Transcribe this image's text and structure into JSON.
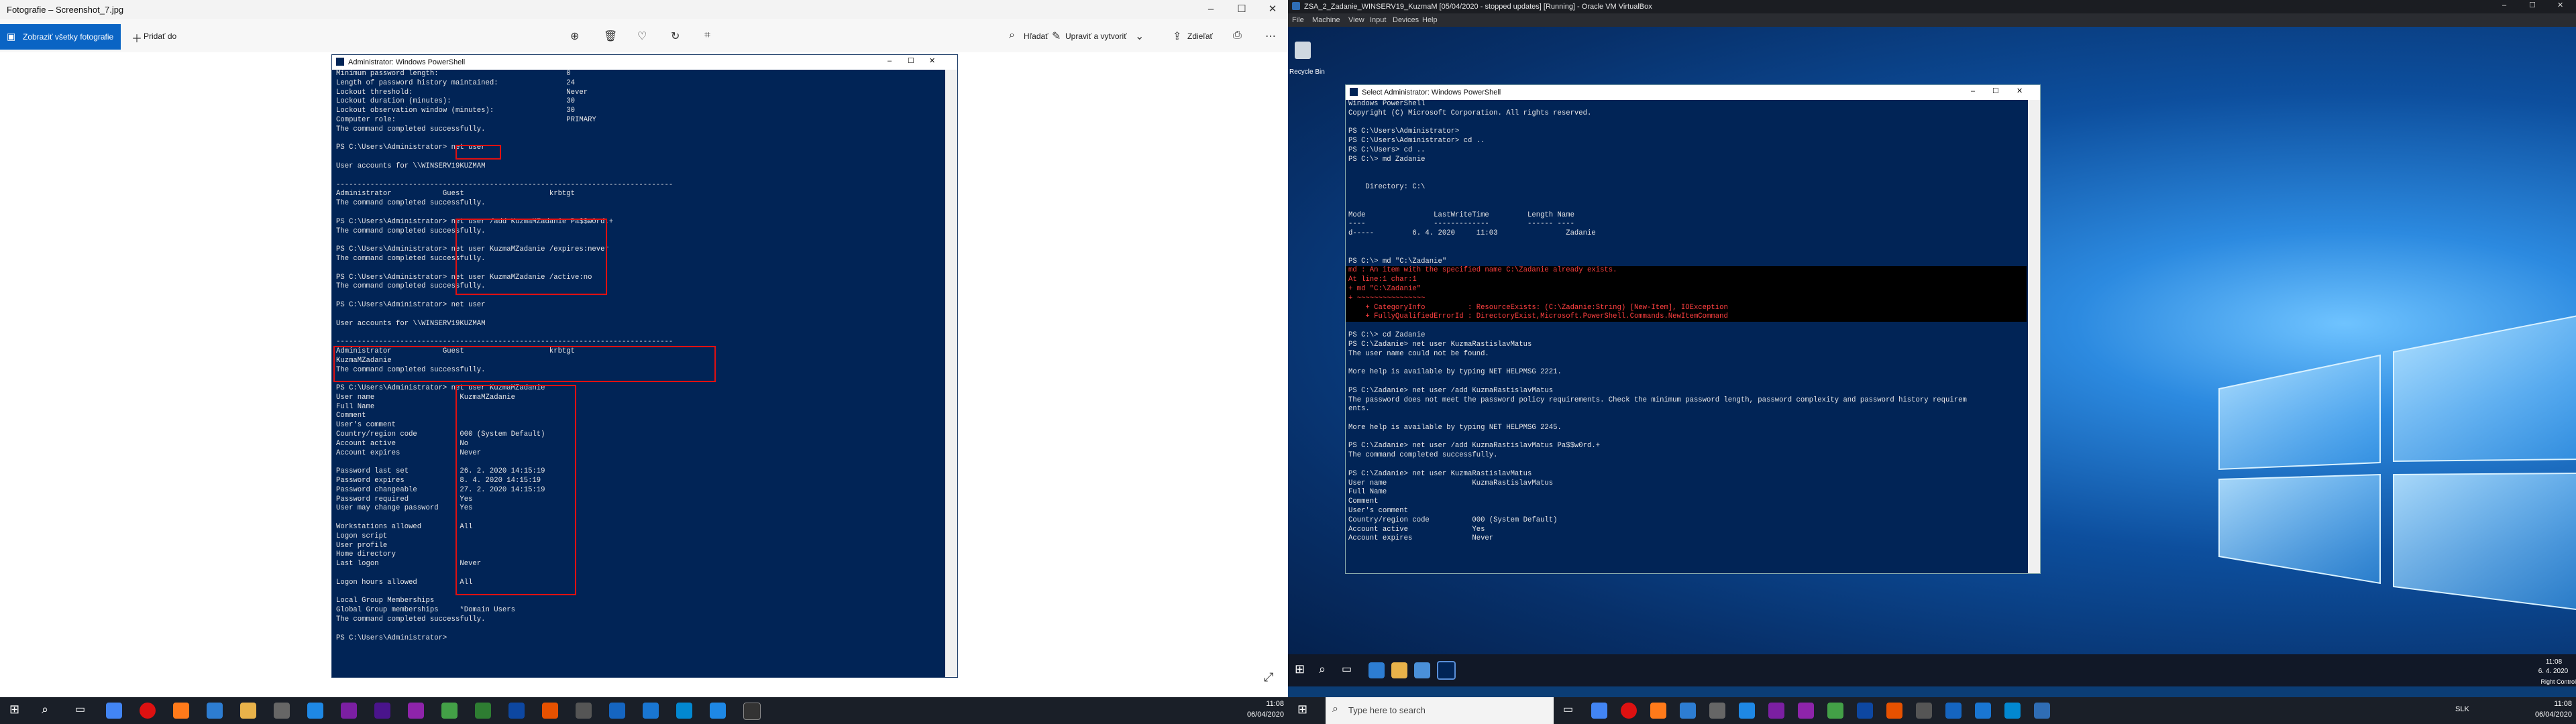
{
  "photos": {
    "title": "Fotografie – Screenshot_7.jpg",
    "all_photos": "Zobraziť všetky fotografie",
    "add_to": "Pridať do",
    "search": "Hľadať",
    "edit_create": "Upraviť a vytvoriť",
    "share": "Zdieľať"
  },
  "ps_photo": {
    "title": "Administrator: Windows PowerShell",
    "lines": [
      "Minimum password length:                              0",
      "Length of password history maintained:                24",
      "Lockout threshold:                                    Never",
      "Lockout duration (minutes):                           30",
      "Lockout observation window (minutes):                 30",
      "Computer role:                                        PRIMARY",
      "The command completed successfully.",
      "",
      "PS C:\\Users\\Administrator> net user",
      "",
      "User accounts for \\\\WINSERV19KUZMAM",
      "",
      "-------------------------------------------------------------------------------",
      "Administrator            Guest                    krbtgt",
      "The command completed successfully.",
      "",
      "PS C:\\Users\\Administrator> net user /add KuzmaMZadanie Pa$$w0rd.+",
      "The command completed successfully.",
      "",
      "PS C:\\Users\\Administrator> net user KuzmaMZadanie /expires:never",
      "The command completed successfully.",
      "",
      "PS C:\\Users\\Administrator> net user KuzmaMZadanie /active:no",
      "The command completed successfully.",
      "",
      "PS C:\\Users\\Administrator> net user",
      "",
      "User accounts for \\\\WINSERV19KUZMAM",
      "",
      "-------------------------------------------------------------------------------",
      "Administrator            Guest                    krbtgt",
      "KuzmaMZadanie",
      "The command completed successfully.",
      "",
      "PS C:\\Users\\Administrator> net user KuzmaMZadanie",
      "User name                    KuzmaMZadanie",
      "Full Name",
      "Comment",
      "User's comment",
      "Country/region code          000 (System Default)",
      "Account active               No",
      "Account expires              Never",
      "",
      "Password last set            26. 2. 2020 14:15:19",
      "Password expires             8. 4. 2020 14:15:19",
      "Password changeable          27. 2. 2020 14:15:19",
      "Password required            Yes",
      "User may change password     Yes",
      "",
      "Workstations allowed         All",
      "Logon script",
      "User profile",
      "Home directory",
      "Last logon                   Never",
      "",
      "Logon hours allowed          All",
      "",
      "Local Group Memberships",
      "Global Group memberships     *Domain Users",
      "The command completed successfully.",
      "",
      "PS C:\\Users\\Administrator>"
    ]
  },
  "vbox": {
    "title": "ZSA_2_Zadanie_WINSERV19_KuzmaM [05/04/2020 - stopped updates] [Running] - Oracle VM VirtualBox",
    "menu": [
      "File",
      "Machine",
      "View",
      "Input",
      "Devices",
      "Help"
    ],
    "recycle_bin": "Recycle Bin"
  },
  "vm_ps": {
    "title": "Select Administrator: Windows PowerShell",
    "lines": [
      {
        "t": "Windows PowerShell",
        "c": ""
      },
      {
        "t": "Copyright (C) Microsoft Corporation. All rights reserved.",
        "c": ""
      },
      {
        "t": "",
        "c": ""
      },
      {
        "t": "PS C:\\Users\\Administrator>",
        "c": ""
      },
      {
        "t": "PS C:\\Users\\Administrator> cd ..",
        "c": ""
      },
      {
        "t": "PS C:\\Users> cd ..",
        "c": ""
      },
      {
        "t": "PS C:\\> md Zadanie",
        "c": ""
      },
      {
        "t": "",
        "c": ""
      },
      {
        "t": "",
        "c": ""
      },
      {
        "t": "    Directory: C:\\",
        "c": ""
      },
      {
        "t": "",
        "c": ""
      },
      {
        "t": "",
        "c": ""
      },
      {
        "t": "Mode                LastWriteTime         Length Name",
        "c": ""
      },
      {
        "t": "----                -------------         ------ ----",
        "c": ""
      },
      {
        "t": "d-----         6. 4. 2020     11:03                Zadanie",
        "c": ""
      },
      {
        "t": "",
        "c": ""
      },
      {
        "t": "",
        "c": ""
      },
      {
        "t": "PS C:\\> md \"C:\\Zadanie\"",
        "c": ""
      },
      {
        "t": "md : An item with the specified name C:\\Zadanie already exists.",
        "c": "err"
      },
      {
        "t": "At line:1 char:1",
        "c": "err"
      },
      {
        "t": "+ md \"C:\\Zadanie\"",
        "c": "err"
      },
      {
        "t": "+ ~~~~~~~~~~~~~~~~",
        "c": "err"
      },
      {
        "t": "    + CategoryInfo          : ResourceExists: (C:\\Zadanie:String) [New-Item], IOException",
        "c": "err"
      },
      {
        "t": "    + FullyQualifiedErrorId : DirectoryExist,Microsoft.PowerShell.Commands.NewItemCommand",
        "c": "err"
      },
      {
        "t": "",
        "c": ""
      },
      {
        "t": "PS C:\\> cd Zadanie",
        "c": ""
      },
      {
        "t": "PS C:\\Zadanie> net user KuzmaRastislavMatus",
        "c": ""
      },
      {
        "t": "The user name could not be found.",
        "c": ""
      },
      {
        "t": "",
        "c": ""
      },
      {
        "t": "More help is available by typing NET HELPMSG 2221.",
        "c": ""
      },
      {
        "t": "",
        "c": ""
      },
      {
        "t": "PS C:\\Zadanie> net user /add KuzmaRastislavMatus",
        "c": ""
      },
      {
        "t": "The password does not meet the password policy requirements. Check the minimum password length, password complexity and password history requirem",
        "c": ""
      },
      {
        "t": "ents.",
        "c": ""
      },
      {
        "t": "",
        "c": ""
      },
      {
        "t": "More help is available by typing NET HELPMSG 2245.",
        "c": ""
      },
      {
        "t": "",
        "c": ""
      },
      {
        "t": "PS C:\\Zadanie> net user /add KuzmaRastislavMatus Pa$$w0rd.+",
        "c": ""
      },
      {
        "t": "The command completed successfully.",
        "c": ""
      },
      {
        "t": "",
        "c": ""
      },
      {
        "t": "PS C:\\Zadanie> net user KuzmaRastislavMatus",
        "c": ""
      },
      {
        "t": "User name                    KuzmaRastislavMatus",
        "c": ""
      },
      {
        "t": "Full Name",
        "c": ""
      },
      {
        "t": "Comment",
        "c": ""
      },
      {
        "t": "User's comment",
        "c": ""
      },
      {
        "t": "Country/region code          000 (System Default)",
        "c": ""
      },
      {
        "t": "Account active               Yes",
        "c": ""
      },
      {
        "t": "Account expires              Never",
        "c": ""
      }
    ]
  },
  "vm_clock": {
    "time": "11:08",
    "date": "6. 4. 2020"
  },
  "vm_tray": {
    "right_control": "Right Control"
  },
  "host": {
    "search_placeholder": "Type here to search",
    "left_time": "11:08",
    "left_date": "06/04/2020",
    "right_time": "11:08",
    "right_date": "06/04/2020",
    "lang": "SLK"
  }
}
